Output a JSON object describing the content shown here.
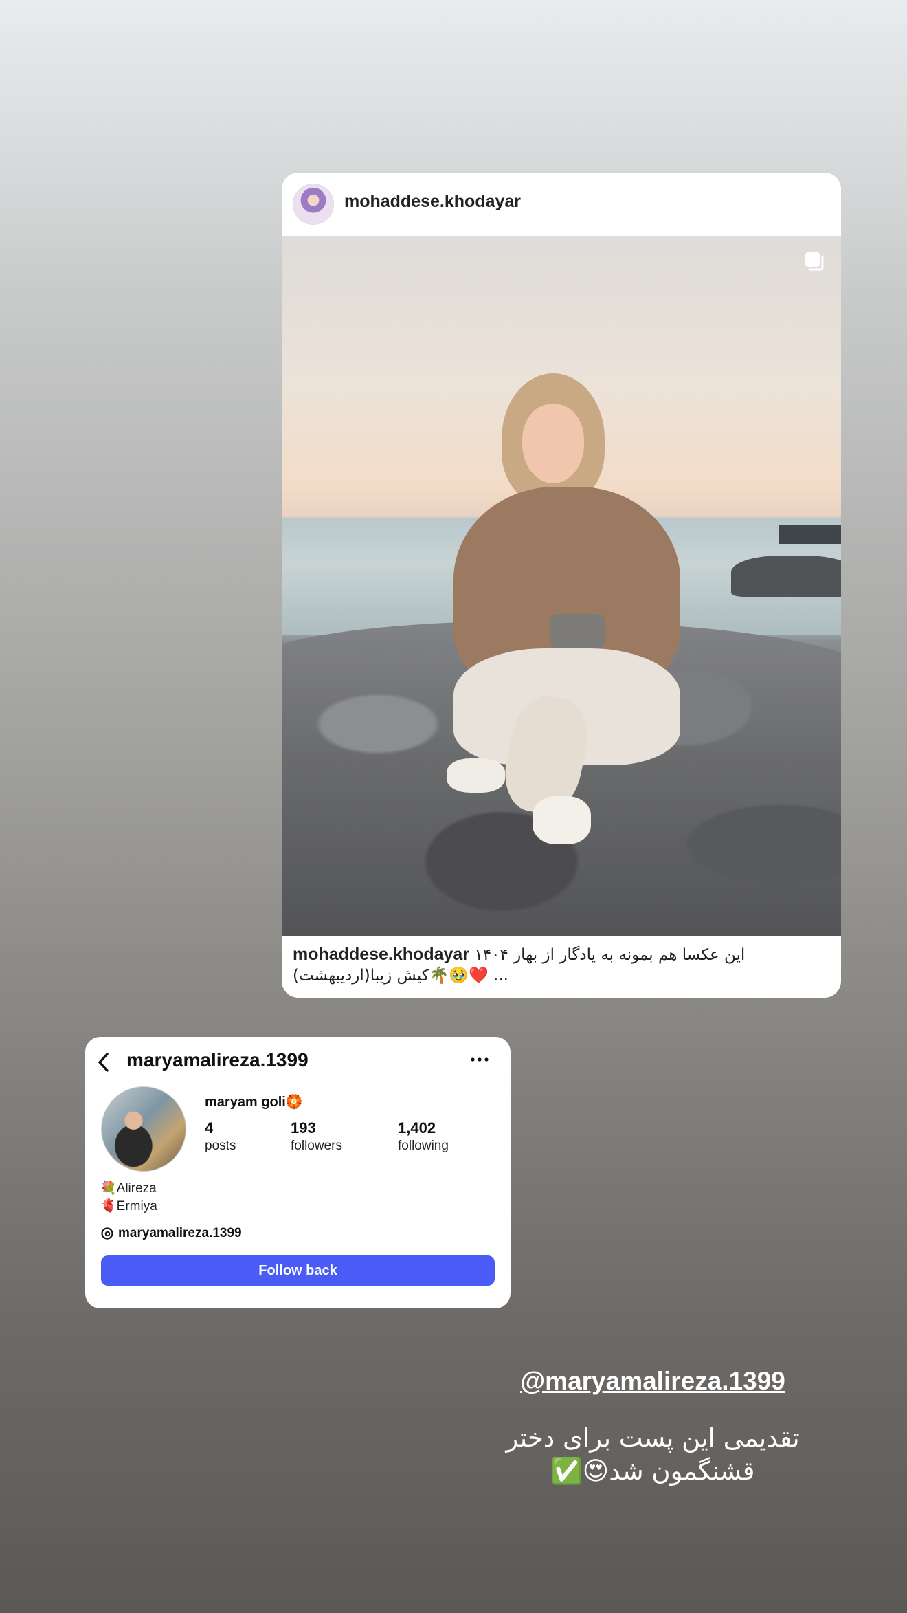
{
  "post": {
    "username": "mohaddese.khodayar",
    "caption_user": "mohaddese.khodayar",
    "caption_line1": "این عکسا هم بمونه به یادگار از بهار ۱۴۰۴",
    "caption_line2": "کیش زیبا(اردیبهشت)🌴🥹❤️ ..."
  },
  "profile": {
    "username": "maryamalireza.1399",
    "display_name": "maryam goli🏵️",
    "stats": [
      {
        "value": "4",
        "label": "posts"
      },
      {
        "value": "193",
        "label": "followers"
      },
      {
        "value": "1,402",
        "label": "following"
      }
    ],
    "bio_line1": "💐Alireza",
    "bio_line2": "🫀Ermiya",
    "threads_handle": "maryamalireza.1399",
    "follow_button": "Follow back"
  },
  "story": {
    "mention": "@maryamalireza.1399",
    "caption_line1": "تقدیمی این پست برای دختر",
    "caption_line2": "قشنگمون شد😍✅"
  }
}
